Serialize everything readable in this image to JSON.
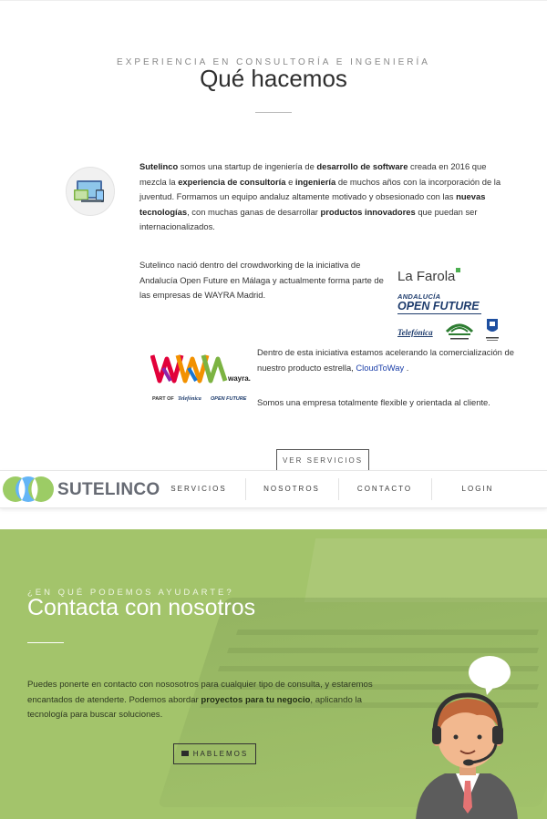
{
  "about": {
    "eyebrow": "EXPERIENCIA EN CONSULTORÍA E INGENIERÍA",
    "title": "Qué hacemos",
    "p1": {
      "t1": "Sutelinco",
      "t2": " somos una startup de ingeniería de ",
      "t3": "desarrollo de software",
      "t4": " creada en 2016 que mezcla la ",
      "t5": "experiencia de consultoría",
      "t6": " e ",
      "t7": "ingeniería",
      "t8": " de muchos años con la incorporación de la juventud. Formamos un equipo andaluz altamente motivado y obsesionado con las ",
      "t9": "nuevas tecnologías",
      "t10": ", con muchas ganas de desarrollar ",
      "t11": "productos innovadores",
      "t12": " que puedan ser internacionalizados."
    },
    "p2": "Sutelinco nació dentro del crowdworking de la iniciativa de Andalucía Open Future en Málaga y actualmente forma parte de las empresas de WAYRA Madrid.",
    "p3_a": "Dentro de esta iniciativa estamos acelerando la comercialización de nuestro producto estrella, ",
    "p3_link": "CloudToWay",
    "p3_b": " .",
    "p3b": "Somos una empresa totalmente flexible y orientada al cliente.",
    "button": "VER SERVICIOS",
    "logos": {
      "farola": "La Farola",
      "aof_small": "ANDALUCÍA",
      "aof_big": "OPEN FUTURE",
      "telefonica": "Telefónica",
      "wayra_word": "wayra.",
      "wayra_part": "PART OF",
      "wayra_tel": "Telefónica",
      "wayra_aof": "OPEN FUTURE"
    }
  },
  "nav": {
    "brand": "SUTELINCO",
    "items": [
      "SERVICIOS",
      "NOSOTROS",
      "CONTACTO",
      "LOGIN"
    ]
  },
  "contact": {
    "eyebrow": "¿EN QUÉ PODEMOS AYUDARTE?",
    "title": "Contacta con nosotros",
    "p_a": "Puedes ponerte en contacto con nososotros para cualquier tipo de consulta, y estaremos encantados de atenderte. Podemos abordar ",
    "p_b": "proyectos para tu negocio",
    "p_c": ", aplicando la tecnología para buscar soluciones.",
    "button": "HABLEMOS"
  },
  "colors": {
    "green_bg": "#a3c46b",
    "brand_grey": "#666a73",
    "link_blue": "#1a3ea8"
  }
}
